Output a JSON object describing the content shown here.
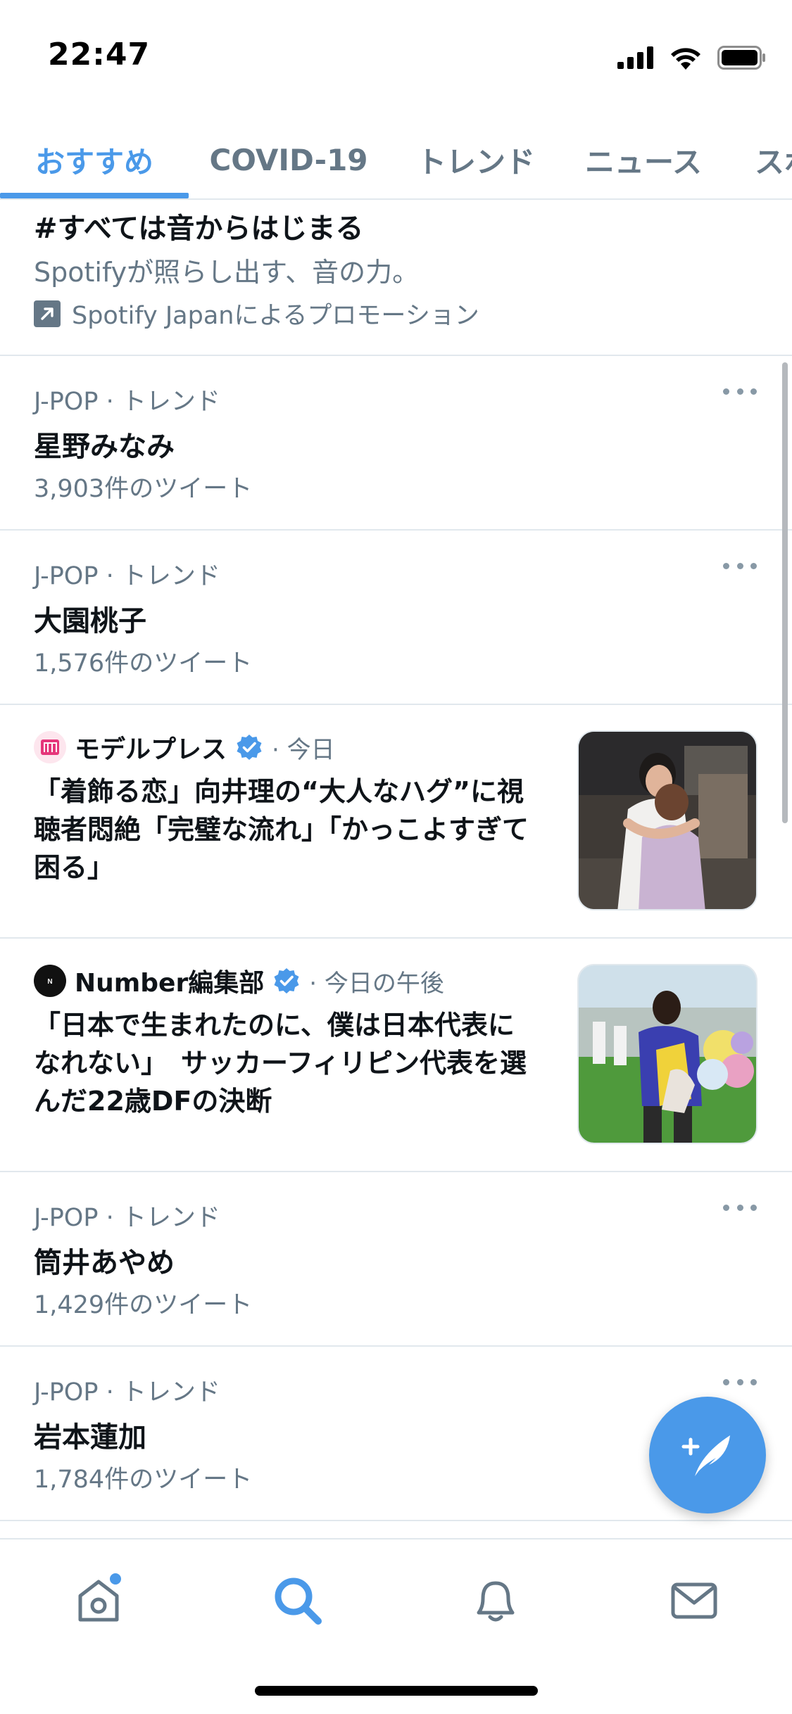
{
  "status_bar": {
    "time": "22:47"
  },
  "tabs": [
    {
      "label": "おすすめ"
    },
    {
      "label": "COVID-19"
    },
    {
      "label": "トレンド"
    },
    {
      "label": "ニュース"
    },
    {
      "label": "スポ"
    }
  ],
  "promoted": {
    "title": "#すべては音からはじまる",
    "description": "Spotifyが照らし出す、音の力。",
    "promoted_by": "Spotify Japanによるプロモーション"
  },
  "trends": [
    {
      "category": "J-POP · トレンド",
      "name": "星野みなみ",
      "count": "3,903件のツイート"
    },
    {
      "category": "J-POP · トレンド",
      "name": "大園桃子",
      "count": "1,576件のツイート"
    },
    {
      "category": "J-POP · トレンド",
      "name": "筒井あやめ",
      "count": "1,429件のツイート"
    },
    {
      "category": "J-POP · トレンド",
      "name": "岩本蓮加",
      "count": "1,784件のツイート"
    }
  ],
  "news": [
    {
      "source": "モデルプレス",
      "time": "· 今日",
      "headline": "「着飾る恋」向井理の“大人なハグ”に視聴者悶絶「完璧な流れ」「かっこよすぎて困る」"
    },
    {
      "source": "Number編集部",
      "time": "· 今日の午後",
      "headline": "「日本で生まれたのに、僕は日本代表になれない」　サッカーフィリピン代表を選んだ22歳DFの決断"
    }
  ],
  "colors": {
    "accent": "#4a99e9",
    "secondary_text": "#657786",
    "primary_text": "#0f1419",
    "divider": "#e1e8ed"
  },
  "icons": {
    "signal": "cellular-signal-icon",
    "wifi": "wifi-icon",
    "battery": "battery-icon",
    "promoted": "promoted-arrow-icon",
    "more": "more-dots-icon",
    "verified": "verified-badge-icon",
    "compose": "compose-tweet-icon",
    "home": "home-icon",
    "search": "search-icon",
    "notifications": "bell-icon",
    "messages": "mail-icon"
  }
}
